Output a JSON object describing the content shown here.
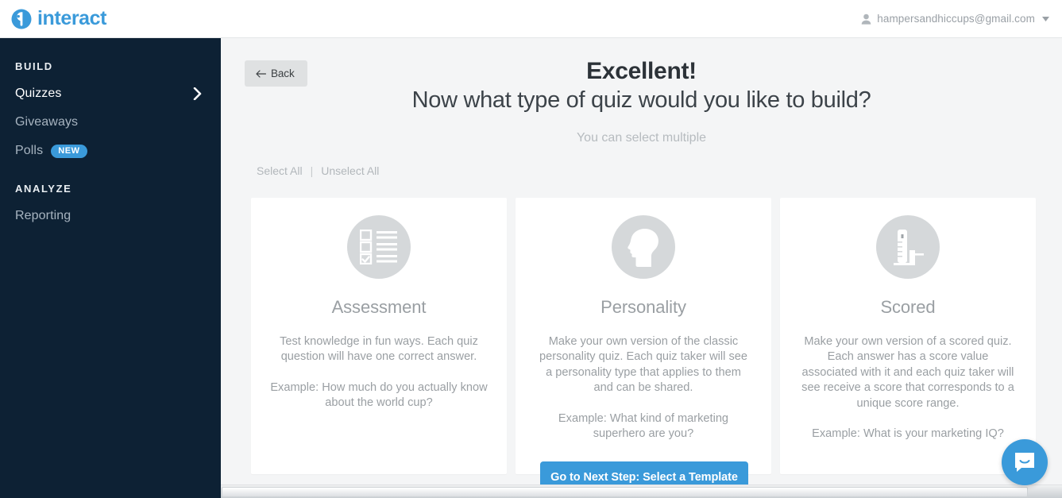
{
  "topbar": {
    "brand_name": "interact",
    "brand_color": "#3a9ada",
    "account_email": "hampersandhiccups@gmail.com"
  },
  "sidebar": {
    "background": "#0d2134",
    "sections": [
      {
        "title": "BUILD",
        "items": [
          {
            "label": "Quizzes",
            "active": true,
            "chevron": true
          },
          {
            "label": "Giveaways",
            "active": false,
            "chevron": false
          },
          {
            "label": "Polls",
            "active": false,
            "badge": "NEW"
          }
        ]
      },
      {
        "title": "ANALYZE",
        "items": [
          {
            "label": "Reporting",
            "active": false,
            "chevron": false
          }
        ]
      }
    ]
  },
  "main": {
    "back_label": "Back",
    "headline": "Excellent!",
    "subhead": "Now what type of quiz would you like to build?",
    "hint": "You can select multiple",
    "select_all": "Select All",
    "separator": "|",
    "unselect_all": "Unselect All",
    "cta_label": "Go to Next Step: Select a Template",
    "cta_color": "#3a9ada"
  },
  "cards": [
    {
      "icon": "checklist-icon",
      "title": "Assessment",
      "description": "Test knowledge in fun ways. Each quiz question will have one correct answer.",
      "example": "Example: How much do you actually know about the world cup?"
    },
    {
      "icon": "head-profile-icon",
      "title": "Personality",
      "description": "Make your own version of the classic personality quiz. Each quiz taker will see a personality type that applies to them and can be shared.",
      "example": "Example: What kind of marketing superhero are you?"
    },
    {
      "icon": "score-meter-icon",
      "title": "Scored",
      "description": "Make your own version of a scored quiz. Each answer has a score value associated with it and each quiz taker will see receive a score that corresponds to a unique score range.",
      "example": "Example: What is your marketing IQ?"
    }
  ],
  "widgets": {
    "intercom_label": "chat-bubble-icon"
  }
}
